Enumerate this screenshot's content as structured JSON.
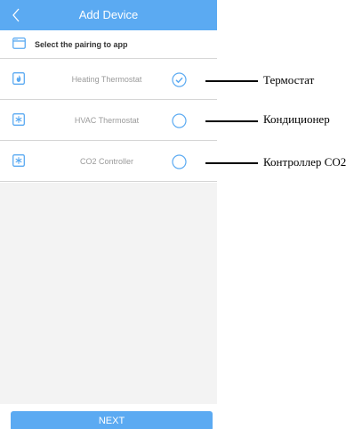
{
  "header": {
    "title": "Add Device",
    "back_icon": "chevron-left-icon",
    "background_color": "#5baaf2"
  },
  "subheader": {
    "text": "Select the pairing to app",
    "icon": "app-window-icon"
  },
  "devices": [
    {
      "label": "Heating Thermostat",
      "icon": "flame-icon",
      "selected": true
    },
    {
      "label": "HVAC Thermostat",
      "icon": "snowflake-icon",
      "selected": false
    },
    {
      "label": "CO2 Controller",
      "icon": "snowflake-icon",
      "selected": false
    }
  ],
  "next_label": "NEXT",
  "annotations": [
    {
      "text": "Термостат"
    },
    {
      "text": "Кондиционер"
    },
    {
      "text": "Контроллер CO2"
    }
  ],
  "colors": {
    "accent": "#5baaf2",
    "divider": "#d6d6d6",
    "list_text": "#9a9a9a",
    "empty_area": "#f3f3f3"
  }
}
